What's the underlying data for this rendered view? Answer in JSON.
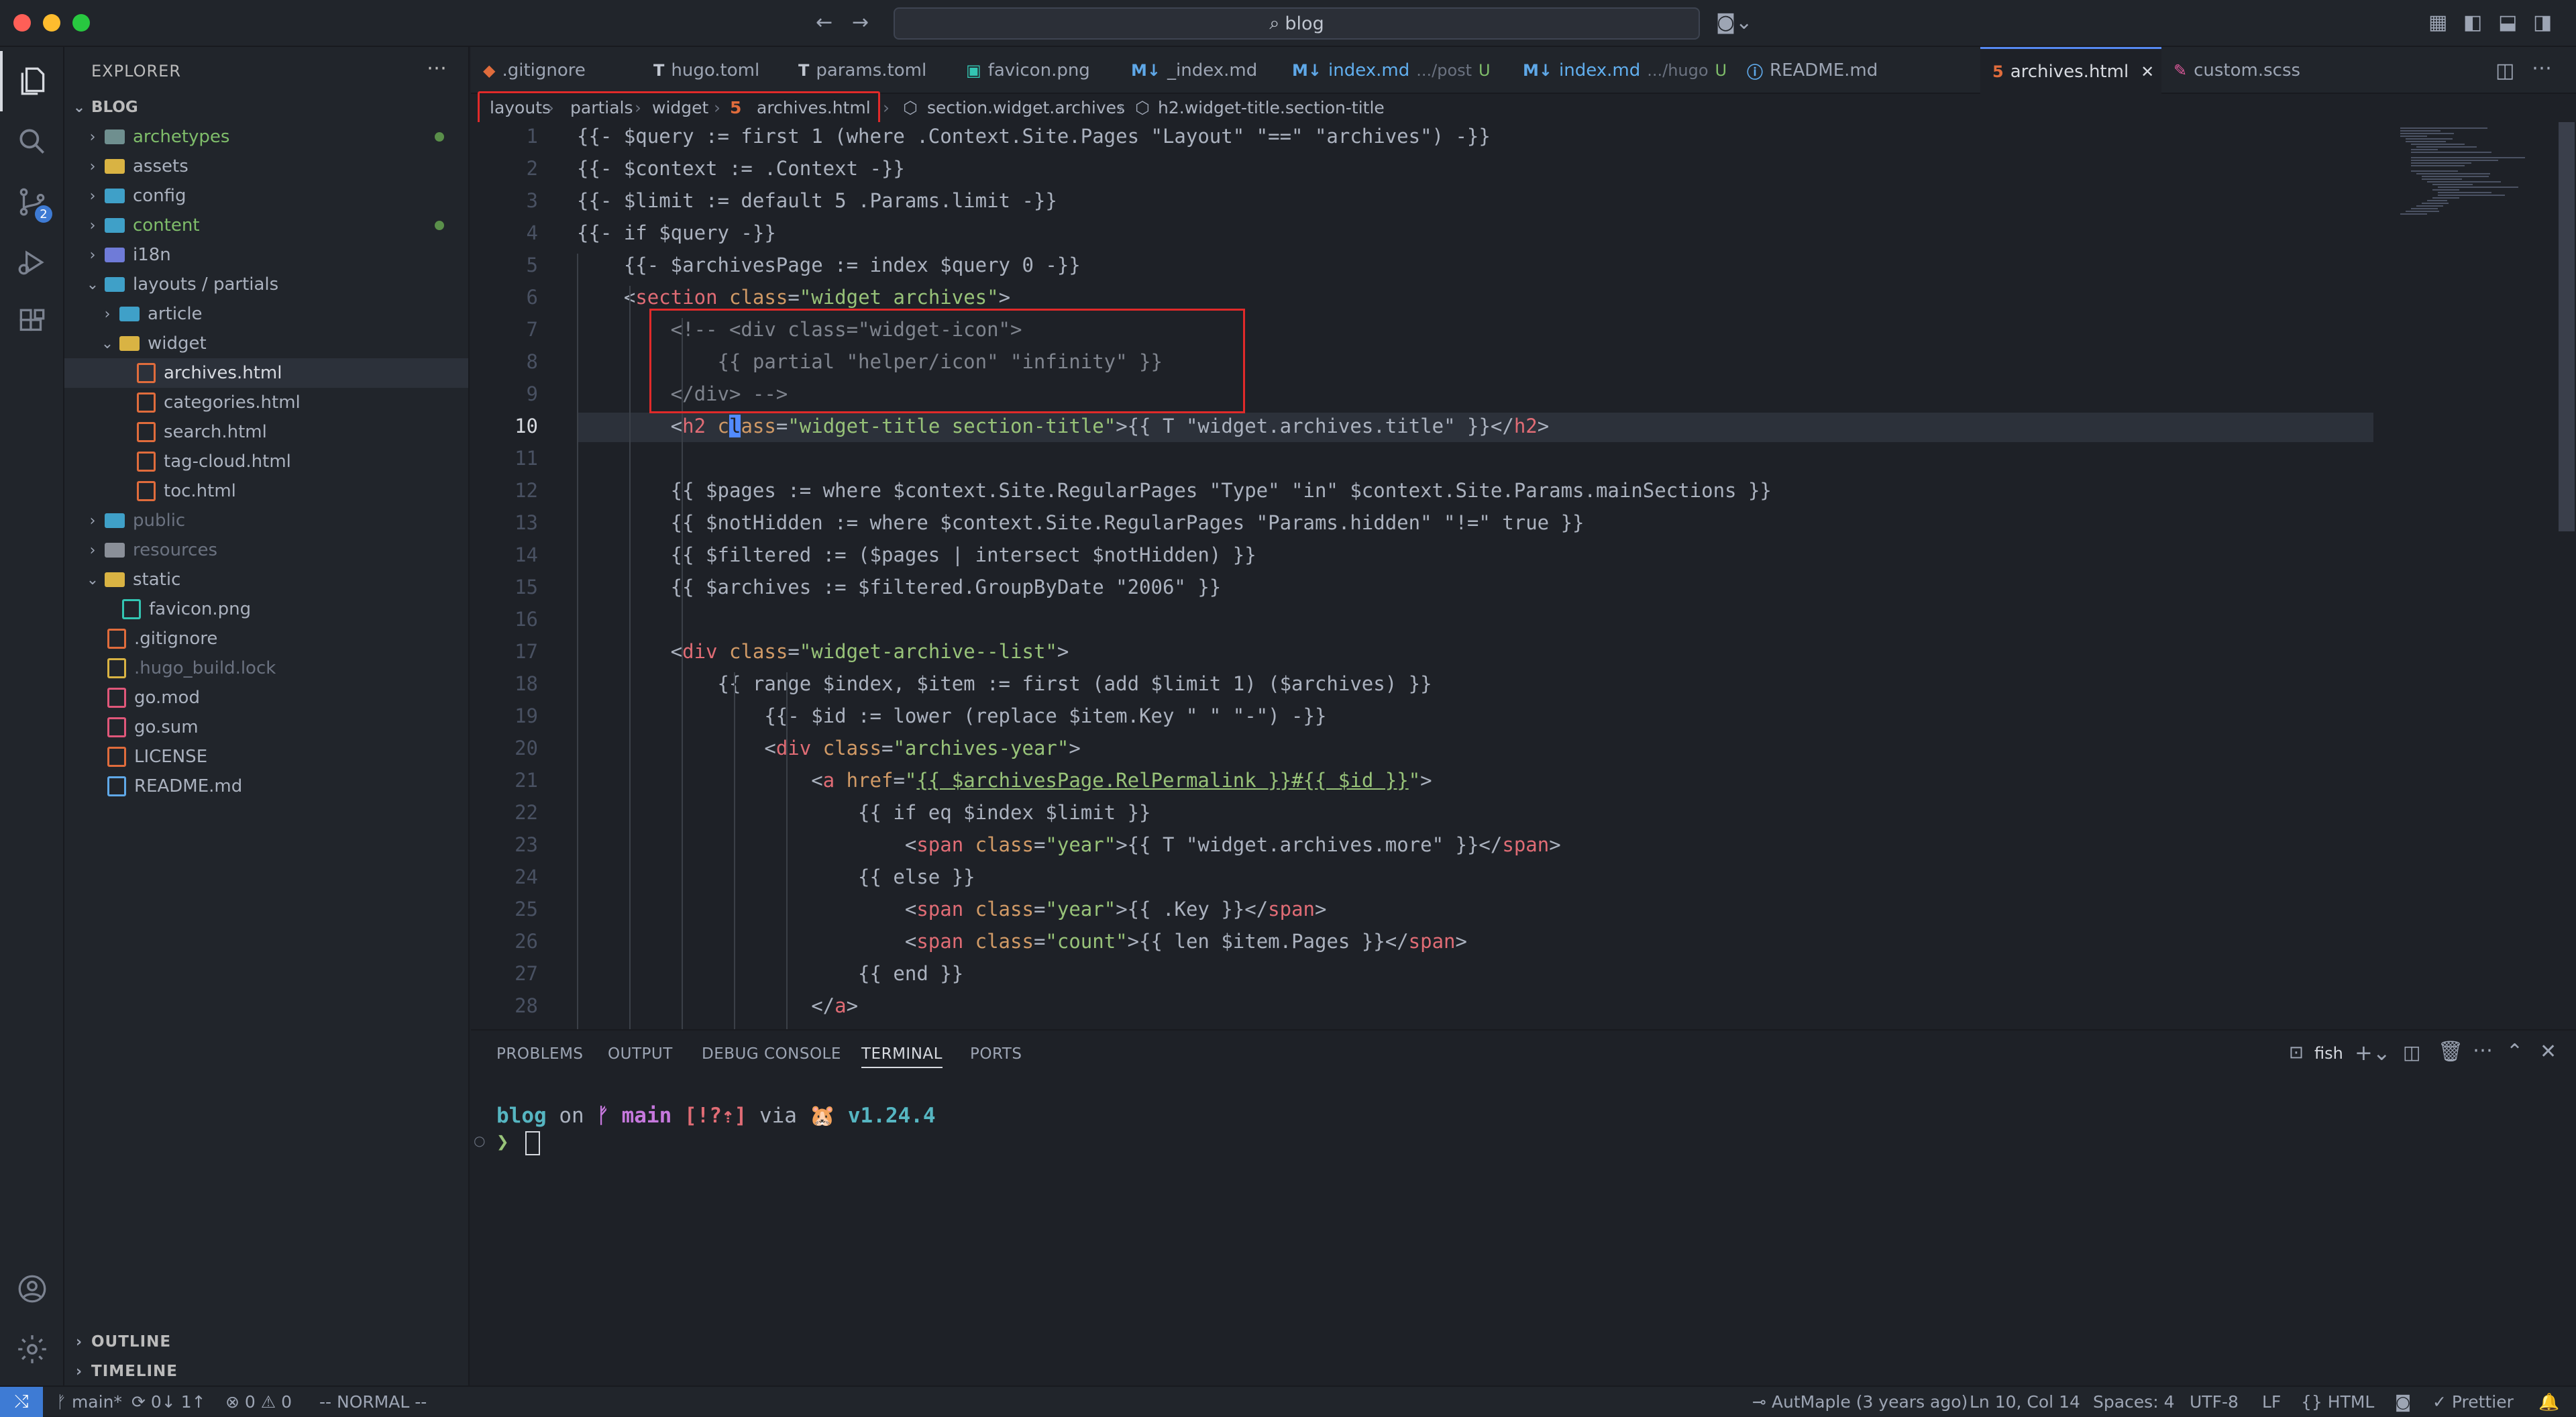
{
  "titlebar": {
    "search": "blog",
    "search_icon": "search-icon"
  },
  "sidebar": {
    "title": "EXPLORER",
    "root": "BLOG",
    "items": [
      {
        "label": "archetypes",
        "type": "folder",
        "depth": 0,
        "color": "#7fbd6a"
      },
      {
        "label": "assets",
        "type": "folder",
        "depth": 0
      },
      {
        "label": "config",
        "type": "folder",
        "depth": 0
      },
      {
        "label": "content",
        "type": "folder",
        "depth": 0,
        "color": "#7fbd6a"
      },
      {
        "label": "i18n",
        "type": "folder",
        "depth": 0
      },
      {
        "label": "layouts / partials",
        "type": "folder-open",
        "depth": 0
      },
      {
        "label": "article",
        "type": "folder",
        "depth": 1
      },
      {
        "label": "widget",
        "type": "folder-open",
        "depth": 1
      },
      {
        "label": "archives.html",
        "type": "html",
        "depth": 2
      },
      {
        "label": "categories.html",
        "type": "html",
        "depth": 2
      },
      {
        "label": "search.html",
        "type": "html",
        "depth": 2
      },
      {
        "label": "tag-cloud.html",
        "type": "html",
        "depth": 2
      },
      {
        "label": "toc.html",
        "type": "html",
        "depth": 2
      },
      {
        "label": "public",
        "type": "folder",
        "depth": 0,
        "color": "#6b7280"
      },
      {
        "label": "resources",
        "type": "folder",
        "depth": 0,
        "color": "#6b7280"
      },
      {
        "label": "static",
        "type": "folder-open",
        "depth": 0
      },
      {
        "label": "favicon.png",
        "type": "png",
        "depth": 1
      },
      {
        "label": ".gitignore",
        "type": "git",
        "depth": 0
      },
      {
        "label": ".hugo_build.lock",
        "type": "lock",
        "depth": 0,
        "color": "#6b7280"
      },
      {
        "label": "go.mod",
        "type": "go",
        "depth": 0
      },
      {
        "label": "go.sum",
        "type": "go",
        "depth": 0
      },
      {
        "label": "LICENSE",
        "type": "license",
        "depth": 0
      },
      {
        "label": "README.md",
        "type": "info",
        "depth": 0
      }
    ],
    "outline": "OUTLINE",
    "timeline": "TIMELINE"
  },
  "tabs": [
    {
      "label": ".gitignore",
      "icon": "git-icon",
      "icon_color": "#e06c3c"
    },
    {
      "label": "hugo.toml",
      "icon": "toml-icon",
      "icon_color": "#c0c6d0"
    },
    {
      "label": "params.toml",
      "icon": "toml-icon",
      "icon_color": "#c0c6d0"
    },
    {
      "label": "favicon.png",
      "icon": "image-icon",
      "icon_color": "#33c6b3"
    },
    {
      "label": "_index.md",
      "icon": "markdown-icon",
      "icon_color": "#5fa8e8"
    },
    {
      "label": "index.md",
      "sub": ".../post",
      "badge": "U",
      "icon": "markdown-icon",
      "icon_color": "#5fa8e8"
    },
    {
      "label": "index.md",
      "sub": ".../hugo",
      "badge": "U",
      "icon": "markdown-icon",
      "icon_color": "#5fa8e8"
    },
    {
      "label": "README.md",
      "icon": "info-icon",
      "icon_color": "#5fa8e8"
    },
    {
      "label": "archives.html",
      "icon": "html-icon",
      "icon_color": "#e06c3c",
      "active": true
    },
    {
      "label": "custom.scss",
      "icon": "sass-icon",
      "icon_color": "#e05a9c"
    }
  ],
  "breadcrumb": [
    "layouts",
    "partials",
    "widget",
    "archives.html",
    "section.widget.archives",
    "h2.widget-title.section-title"
  ],
  "editor": {
    "current_line": 10,
    "lines": [
      "{{- $query := first 1 (where .Context.Site.Pages \"Layout\" \"==\" \"archives\") -}}",
      "{{- $context := .Context -}}",
      "{{- $limit := default 5 .Params.limit -}}",
      "{{- if $query -}}",
      "    {{- $archivesPage := index $query 0 -}}",
      "    <section class=\"widget archives\">",
      "        <!-- <div class=\"widget-icon\">",
      "            {{ partial \"helper/icon\" \"infinity\" }}",
      "        </div> -->",
      "        <h2 class=\"widget-title section-title\">{{ T \"widget.archives.title\" }}</h2>",
      "",
      "        {{ $pages := where $context.Site.RegularPages \"Type\" \"in\" $context.Site.Params.mainSections }}",
      "        {{ $notHidden := where $context.Site.RegularPages \"Params.hidden\" \"!=\" true }}",
      "        {{ $filtered := ($pages | intersect $notHidden) }}",
      "        {{ $archives := $filtered.GroupByDate \"2006\" }}",
      "",
      "        <div class=\"widget-archive--list\">",
      "            {{ range $index, $item := first (add $limit 1) ($archives) }}",
      "                {{- $id := lower (replace $item.Key \" \" \"-\") -}}",
      "                <div class=\"archives-year\">",
      "                    <a href=\"{{ $archivesPage.RelPermalink }}#{{ $id }}\">",
      "                        {{ if eq $index $limit }}",
      "                            <span class=\"year\">{{ T \"widget.archives.more\" }}</span>",
      "                        {{ else }}",
      "                            <span class=\"year\">{{ .Key }}</span>",
      "                            <span class=\"count\">{{ len $item.Pages }}</span>",
      "                        {{ end }}",
      "                    </a>"
    ]
  },
  "panel": {
    "tabs": [
      "PROBLEMS",
      "OUTPUT",
      "DEBUG CONSOLE",
      "TERMINAL",
      "PORTS"
    ],
    "active_tab": "TERMINAL",
    "shell": "fish",
    "terminal": {
      "dir": "blog",
      "on": "on",
      "branch_icon": "ᚠ",
      "branch": "main",
      "status": "[!?⇡]",
      "via": "via",
      "emoji": "🐹",
      "version": "v1.24.4",
      "prompt": "❯"
    }
  },
  "statusbar": {
    "branch": "main*",
    "sync": "0↓ 1↑",
    "errors": "0",
    "warnings": "0",
    "mode": "-- NORMAL --",
    "blame": "AutMaple (3 years ago)",
    "position": "Ln 10, Col 14",
    "spaces": "Spaces: 4",
    "encoding": "UTF-8",
    "eol": "LF",
    "language": "HTML",
    "formatter": "Prettier"
  },
  "colors": {
    "accent": "#3e7bd4",
    "highlight_box": "#e02a2a",
    "git_added": "#7fbd6a"
  }
}
